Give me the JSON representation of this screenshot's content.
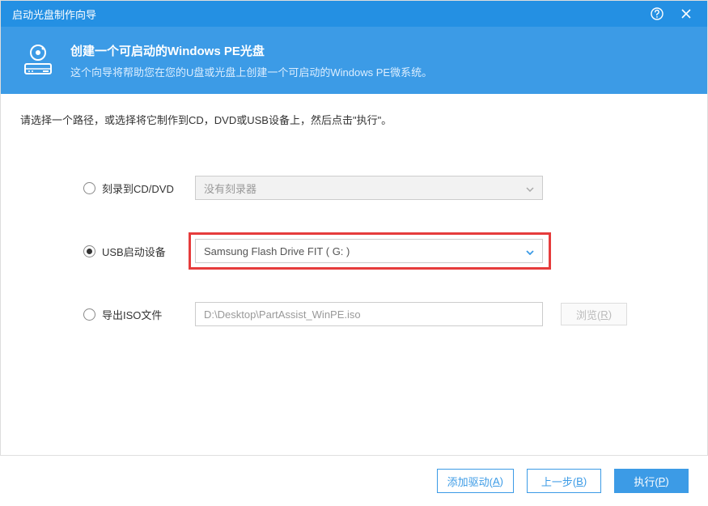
{
  "titlebar": {
    "title": "启动光盘制作向导"
  },
  "header": {
    "title": "创建一个可启动的Windows PE光盘",
    "subtitle": "这个向导将帮助您在您的U盘或光盘上创建一个可启动的Windows PE微系统。"
  },
  "instructions": "请选择一个路径，或选择将它制作到CD，DVD或USB设备上，然后点击\"执行\"。",
  "options": {
    "cddvd": {
      "label": "刻录到CD/DVD",
      "value": "没有刻录器"
    },
    "usb": {
      "label": "USB启动设备",
      "value": "Samsung Flash Drive FIT ( G: )"
    },
    "iso": {
      "label": "导出ISO文件",
      "value": "D:\\Desktop\\PartAssist_WinPE.iso",
      "browse_prefix": "浏览(",
      "browse_key": "R",
      "browse_suffix": ")"
    }
  },
  "footer": {
    "add_driver_prefix": "添加驱动(",
    "add_driver_key": "A",
    "add_driver_suffix": ")",
    "prev_prefix": "上一步(",
    "prev_key": "B",
    "prev_suffix": ")",
    "exec_prefix": "执行(",
    "exec_key": "P",
    "exec_suffix": ")"
  }
}
